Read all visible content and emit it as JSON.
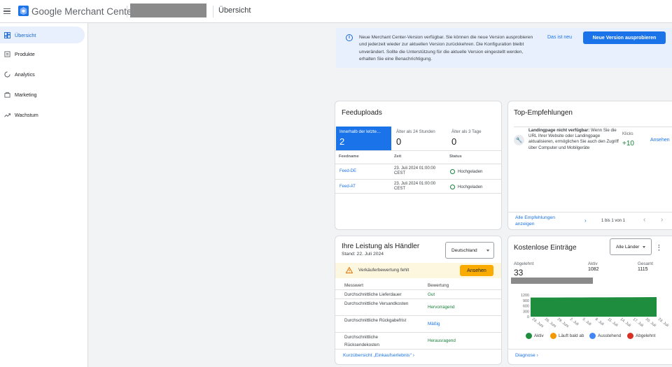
{
  "header": {
    "brand": "Google Merchant Center",
    "page_title": "Übersicht"
  },
  "sidebar": {
    "items": [
      {
        "label": "Übersicht",
        "icon": "dashboard-icon",
        "active": true
      },
      {
        "label": "Produkte",
        "icon": "products-icon",
        "active": false
      },
      {
        "label": "Analytics",
        "icon": "analytics-icon",
        "active": false
      },
      {
        "label": "Marketing",
        "icon": "marketing-icon",
        "active": false
      },
      {
        "label": "Wachstum",
        "icon": "growth-icon",
        "active": false
      }
    ]
  },
  "banner": {
    "message": "Neue Merchant Center-Version verfügbar. Sie können die neue Version ausprobieren und jederzeit wieder zur aktuellen Version zurückkehren. Die Konfiguration bleibt unverändert. Sollte die Unterstützung für die aktuelle Version eingestellt werden, erhalten Sie eine Benachrichtigung.",
    "link": "Das ist neu",
    "button": "Neue Version ausprobieren"
  },
  "feeduploads": {
    "title": "Feeduploads",
    "tabs": [
      {
        "label": "Innerhalb der letzte…",
        "value": "2"
      },
      {
        "label": "Älter als 24 Stunden",
        "value": "0"
      },
      {
        "label": "Älter als 3 Tage",
        "value": "0"
      }
    ],
    "headers": [
      "Feedname",
      "Zeit",
      "Status"
    ],
    "rows": [
      {
        "name": "Feed-DE",
        "time": "23. Juli 2024 01:00:00 CEST",
        "status": "Hochgeladen"
      },
      {
        "name": "Feed-AT",
        "time": "23. Juli 2024 01:00:00 CEST",
        "status": "Hochgeladen"
      }
    ]
  },
  "top": {
    "title": "Top-Empfehlungen",
    "item_bold": "Landingpage nicht verfügbar:",
    "item_text": " Wenn Sie die URL Ihrer Website oder Landingpage aktualisieren, ermöglichen Sie auch den Zugriff über Computer und Mobilgeräte",
    "clicks_label": "Klicks",
    "clicks_value": "+10",
    "action": "Ansehen",
    "footer_link": "Alle Empfehlungen anzeigen",
    "pager": "1 bis 1 von 1"
  },
  "performance": {
    "title": "Ihre Leistung als Händler",
    "subtitle": "Stand: 22. Juli 2024",
    "country": "Deutschland",
    "warning": "Verkäuferbewertung fehlt",
    "warning_action": "Ansehen",
    "col_metric": "Messwert",
    "col_rating": "Bewertung",
    "rows": [
      {
        "metric": "Durchschnittliche Lieferdauer",
        "rating": "Gut",
        "color": "#188038"
      },
      {
        "metric": "Durchschnittliche Versandkosten",
        "rating": "Hervorragend",
        "color": "#188038"
      },
      {
        "metric": "Durchschnittliche Rückgabefrist",
        "rating": "Mäßig",
        "color": "#1a73e8"
      },
      {
        "metric": "Durchschnittliche Rücksendekosten",
        "rating": "Herausragend",
        "color": "#188038"
      }
    ],
    "footer_link": "Kurzübersicht „Einkaufserlebnis“"
  },
  "free": {
    "title": "Kostenlose Einträge",
    "filter": "Alle Länder",
    "stats": [
      {
        "label": "Abgelehnt",
        "value": "33"
      },
      {
        "label": "Aktiv",
        "value": "1082"
      },
      {
        "label": "Gesamt",
        "value": "1115"
      }
    ],
    "footer_link": "Diagnose"
  },
  "chart_data": {
    "type": "area",
    "x": [
      "23. Juni",
      "26. Juni",
      "29. Juni",
      "2. Juli",
      "5. Juli",
      "8. Juli",
      "11. Juli",
      "14. Juli",
      "17. Juli",
      "20. Juli",
      "23. Juli"
    ],
    "yticks": [
      0,
      300,
      600,
      900,
      1200
    ],
    "ylim": [
      0,
      1200
    ],
    "series": [
      {
        "name": "Aktiv",
        "color": "#1e8e3e",
        "values": [
          1060,
          1060,
          1062,
          1064,
          1066,
          1068,
          1070,
          1072,
          1075,
          1078,
          1082
        ]
      },
      {
        "name": "Läuft bald ab",
        "color": "#f29900",
        "values": [
          0,
          0,
          0,
          0,
          0,
          0,
          0,
          0,
          0,
          0,
          0
        ]
      },
      {
        "name": "Ausstehend",
        "color": "#4285f4",
        "values": [
          0,
          0,
          0,
          0,
          0,
          0,
          0,
          0,
          0,
          0,
          0
        ]
      },
      {
        "name": "Abgelehnt",
        "color": "#d93025",
        "values": [
          0,
          0,
          0,
          0,
          0,
          0,
          0,
          0,
          0,
          0,
          0
        ]
      }
    ],
    "legend": "bottom"
  }
}
